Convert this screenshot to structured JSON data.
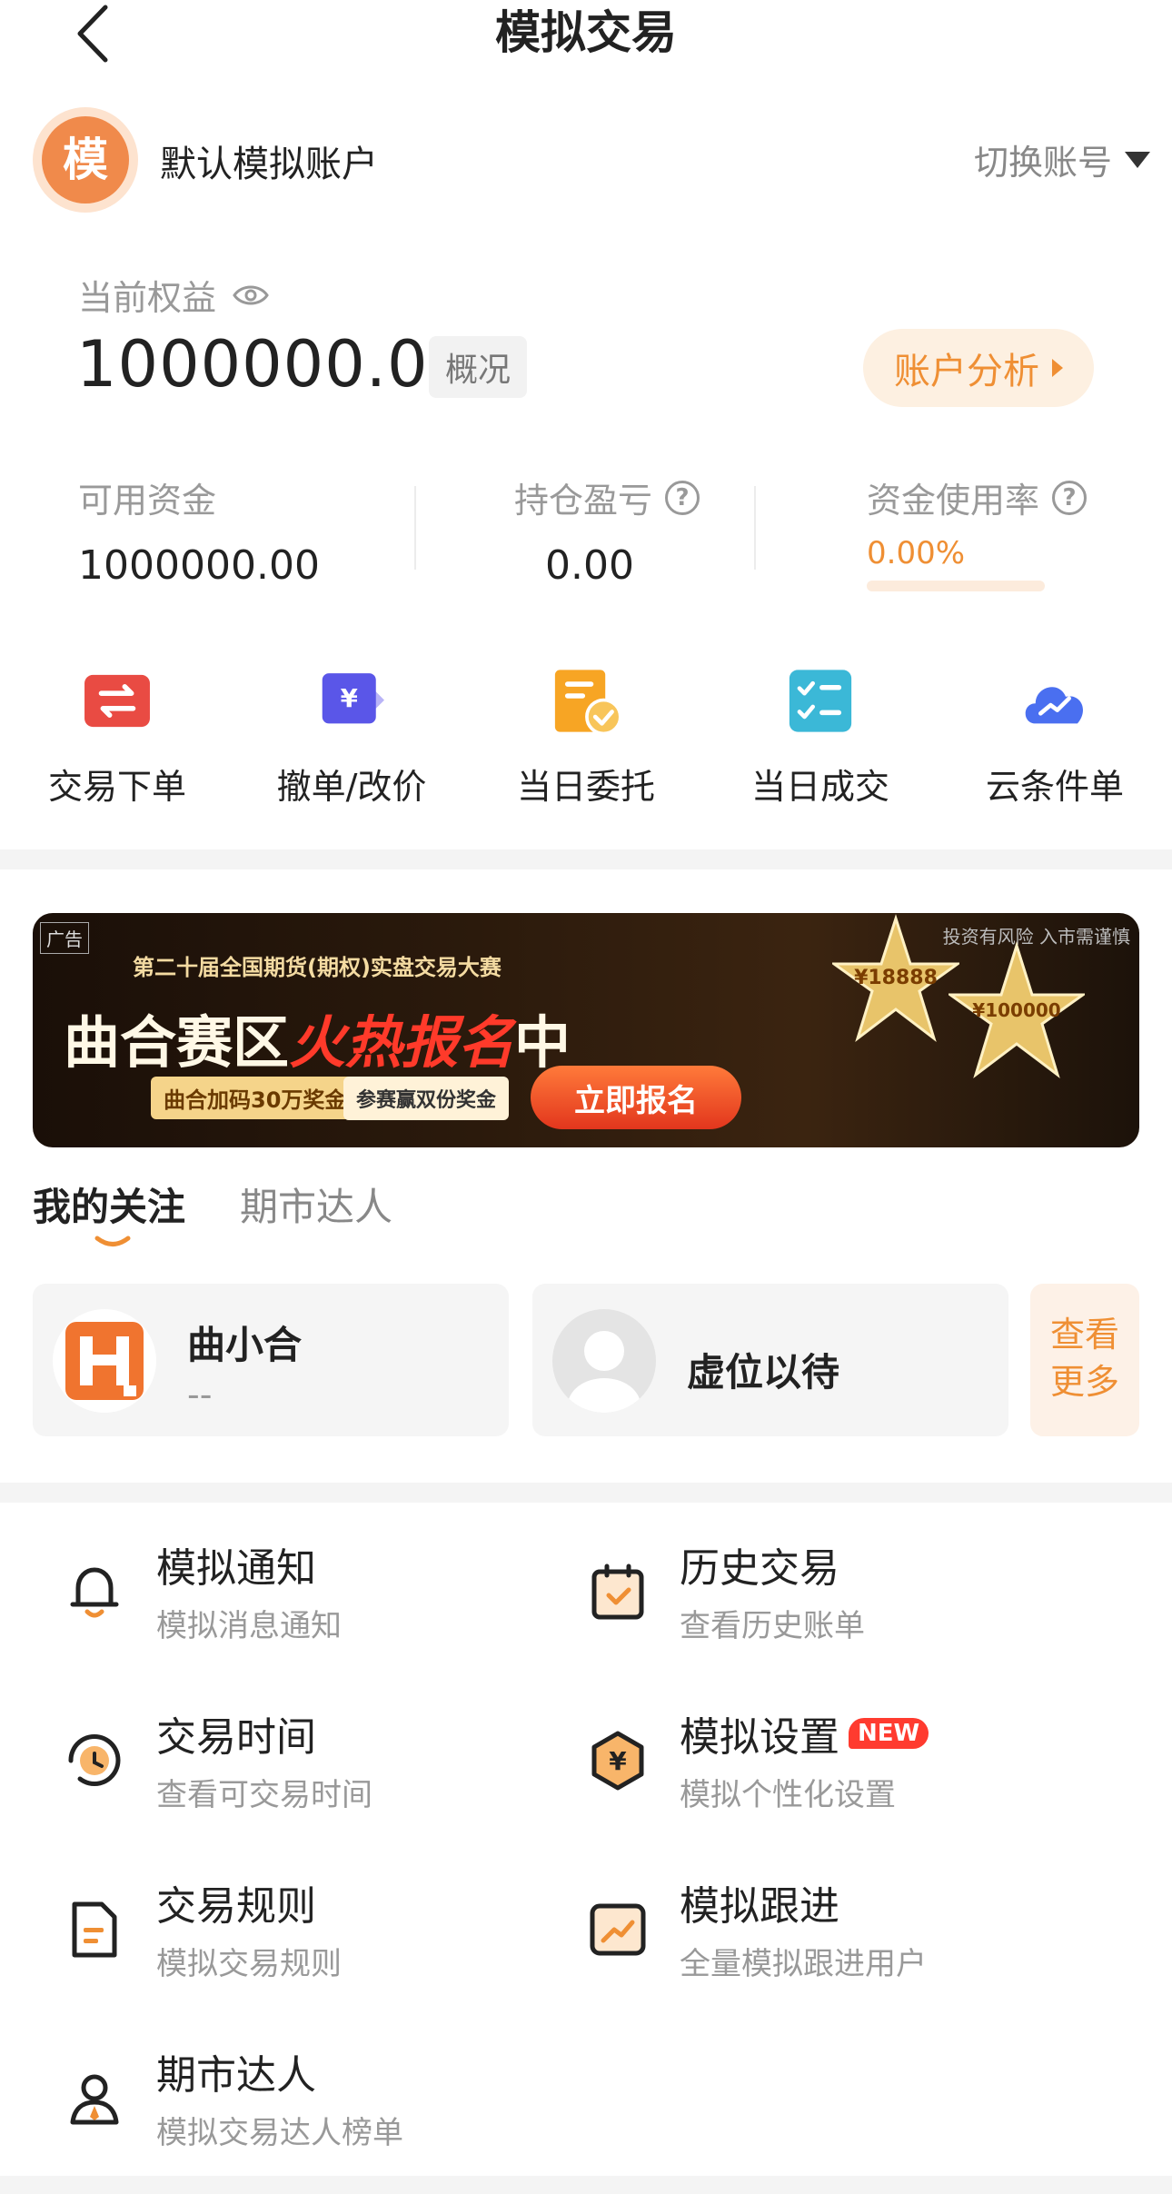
{
  "header": {
    "title": "模拟交易"
  },
  "account": {
    "avatar_char": "模",
    "name": "默认模拟账户",
    "switch_label": "切换账号"
  },
  "equity": {
    "label": "当前权益",
    "value": "1000000.00",
    "overview_label": "概况",
    "analysis_label": "账户分析"
  },
  "stats": [
    {
      "label": "可用资金",
      "value": "1000000.00"
    },
    {
      "label": "持仓盈亏",
      "value": "0.00"
    },
    {
      "label": "资金使用率",
      "value": "0.00%",
      "usage_fraction": 0.0
    }
  ],
  "quick_actions": [
    {
      "label": "交易下单",
      "icon": "exchange-icon"
    },
    {
      "label": "撤单/改价",
      "icon": "yuan-card-icon"
    },
    {
      "label": "当日委托",
      "icon": "entrust-doc-icon"
    },
    {
      "label": "当日成交",
      "icon": "checklist-icon"
    },
    {
      "label": "云条件单",
      "icon": "cloud-chart-icon"
    }
  ],
  "banner": {
    "ad_tag": "广告",
    "risk_note": "投资有风险 入市需谨慎",
    "subtitle": "第二十届全国期货(期权)实盘交易大赛",
    "headline_a": "曲合赛区",
    "headline_b": "火热报名",
    "headline_c": "中",
    "bonus_1": "曲合加码30万奖金",
    "bonus_2": "参赛赢双份奖金",
    "cta": "立即报名",
    "prize_1": "¥18888",
    "prize_2": "¥100000"
  },
  "tabs": [
    {
      "label": "我的关注",
      "active": true
    },
    {
      "label": "期市达人",
      "active": false
    }
  ],
  "follows": [
    {
      "name": "曲小合",
      "sub": "--"
    },
    {
      "name": "虚位以待",
      "sub": ""
    }
  ],
  "more_label_1": "查看",
  "more_label_2": "更多",
  "menu": [
    {
      "title": "模拟通知",
      "sub": "模拟消息通知",
      "icon": "bell-icon"
    },
    {
      "title": "历史交易",
      "sub": "查看历史账单",
      "icon": "calendar-check-icon"
    },
    {
      "title": "交易时间",
      "sub": "查看可交易时间",
      "icon": "clock-icon"
    },
    {
      "title": "模拟设置",
      "sub": "模拟个性化设置",
      "icon": "yuan-hex-icon",
      "badge": "NEW"
    },
    {
      "title": "交易规则",
      "sub": "模拟交易规则",
      "icon": "document-icon"
    },
    {
      "title": "模拟跟进",
      "sub": "全量模拟跟进用户",
      "icon": "trend-icon"
    },
    {
      "title": "期市达人",
      "sub": "模拟交易达人榜单",
      "icon": "person-icon"
    }
  ],
  "colors": {
    "accent": "#ef8f34",
    "avatar": "#f08a4b",
    "red": "#ff3b2f"
  }
}
